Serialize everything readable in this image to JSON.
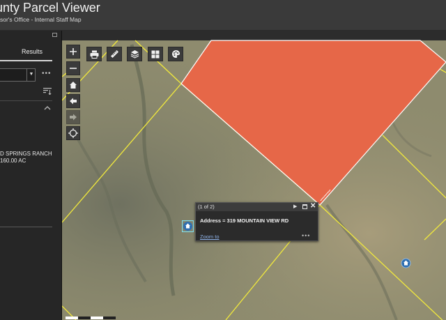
{
  "header": {
    "title": "unty Parcel Viewer",
    "subtitle": "sor's Office - Internal Staff Map"
  },
  "panel": {
    "tab_label": "Results",
    "result": {
      "line1": "D SPRINGS RANCH",
      "line2": "160.00 AC"
    },
    "icons": {
      "pin": "panel-dock-icon",
      "dropdown": "chevron-down-icon",
      "more": "more-options-icon",
      "sort": "sort-icon",
      "collapse": "chevron-up-icon"
    }
  },
  "map": {
    "tools_vertical": [
      "zoom-in-icon",
      "zoom-out-icon",
      "home-icon",
      "back-icon",
      "forward-icon",
      "locate-icon"
    ],
    "tools_horizontal": [
      "print-icon",
      "measure-icon",
      "layers-icon",
      "basemap-gallery-icon",
      "palette-icon"
    ],
    "highlight_color": "#e66748",
    "parcel_line_color": "#f2ea3c",
    "popup": {
      "count": "(1 of 2)",
      "address": "Address = 319 MOUNTAIN VIEW RD",
      "zoom_link": "Zoom to",
      "more": "•••"
    },
    "markers": [
      "address-point-icon",
      "address-point-icon"
    ]
  }
}
